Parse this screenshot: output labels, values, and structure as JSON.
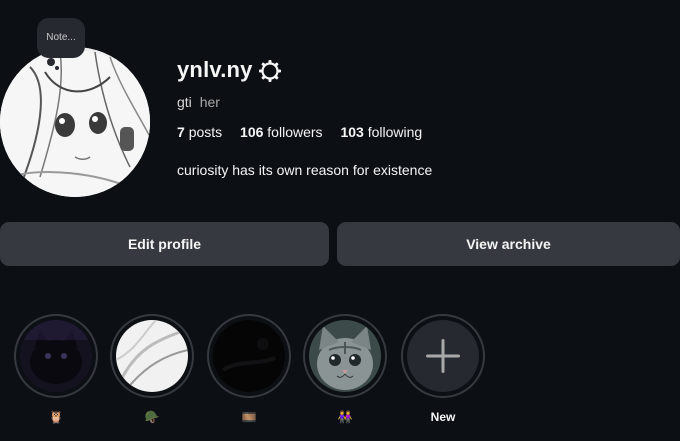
{
  "note": {
    "text": "Note..."
  },
  "profile": {
    "username": "ynlv.ny",
    "name": "gti",
    "pronouns": "her",
    "bio": "curiosity has its own reason for existence"
  },
  "stats": {
    "posts_count": "7",
    "posts_label": "posts",
    "followers_count": "106",
    "followers_label": "followers",
    "following_count": "103",
    "following_label": "following"
  },
  "buttons": {
    "edit_profile": "Edit profile",
    "view_archive": "View archive"
  },
  "highlights": [
    {
      "label": "🦉",
      "icon": "dark-cat-photo"
    },
    {
      "label": "🪖",
      "icon": "white-sketch-photo"
    },
    {
      "label": "🎞️",
      "icon": "dark-photo"
    },
    {
      "label": "👭",
      "icon": "tabby-cat-photo"
    },
    {
      "label": "New",
      "icon": "plus-icon"
    }
  ],
  "colors": {
    "background": "#0c1014",
    "button": "#363a40",
    "text": "#f5f5f5",
    "muted": "#a8a8a8"
  }
}
